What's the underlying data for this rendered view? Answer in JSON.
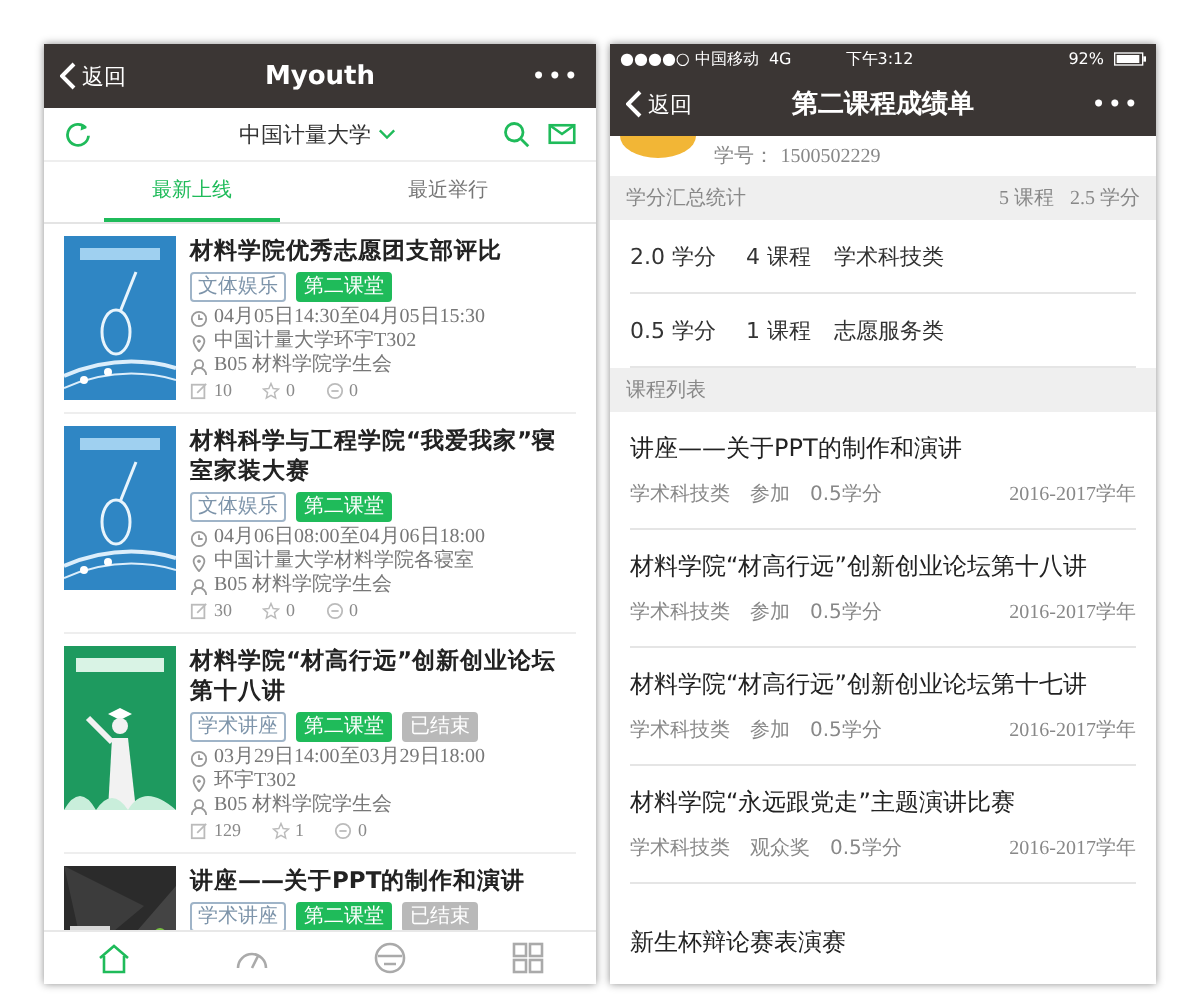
{
  "left_screen": {
    "nav": {
      "back": "返回",
      "title": "Myouth",
      "more": "•••"
    },
    "toolbar": {
      "school": "中国计量大学"
    },
    "tabs": [
      {
        "label": "最新上线",
        "selected": true
      },
      {
        "label": "最近举行",
        "selected": false
      }
    ],
    "activities": [
      {
        "poster": {
          "kind": "arts"
        },
        "title": "材料学院优秀志愿团支部评比",
        "tags": [
          {
            "label": "文体娱乐",
            "kind": "category"
          },
          {
            "label": "第二课堂",
            "kind": "course"
          }
        ],
        "time": "04月05日14:30至04月05日15:30",
        "place": "中国计量大学环宇T302",
        "organizer": "B05 材料学院学生会",
        "stats": {
          "views": "10",
          "likes": "0",
          "comments": "0"
        }
      },
      {
        "poster": {
          "kind": "arts"
        },
        "title": "材料科学与工程学院“我爱我家”寝室家装大赛",
        "tags": [
          {
            "label": "文体娱乐",
            "kind": "category"
          },
          {
            "label": "第二课堂",
            "kind": "course"
          }
        ],
        "time": "04月06日08:00至04月06日18:00",
        "place": "中国计量大学材料学院各寝室",
        "organizer": "B05 材料学院学生会",
        "stats": {
          "views": "30",
          "likes": "0",
          "comments": "0"
        }
      },
      {
        "poster": {
          "kind": "lecture"
        },
        "title": "材料学院“材高行远”创新创业论坛第十八讲",
        "tags": [
          {
            "label": "学术讲座",
            "kind": "category"
          },
          {
            "label": "第二课堂",
            "kind": "course"
          },
          {
            "label": "已结束",
            "kind": "ended"
          }
        ],
        "time": "03月29日14:00至03月29日18:00",
        "place": "环宇T302",
        "organizer": "B05 材料学院学生会",
        "stats": {
          "views": "129",
          "likes": "1",
          "comments": "0"
        }
      },
      {
        "poster": {
          "kind": "dark"
        },
        "title": "讲座——关于PPT的制作和演讲",
        "tags": [
          {
            "label": "学术讲座",
            "kind": "category"
          },
          {
            "label": "第二课堂",
            "kind": "course"
          },
          {
            "label": "已结束",
            "kind": "ended"
          }
        ]
      }
    ],
    "bottom_tabs": [
      {
        "selected": true
      },
      {
        "selected": false
      },
      {
        "selected": false
      },
      {
        "selected": false
      }
    ]
  },
  "right_screen": {
    "status_bar": {
      "carrier": "●●●●○ 中国移动",
      "network": "4G",
      "time": "下午3:12",
      "battery": "92%"
    },
    "nav": {
      "back": "返回",
      "title": "第二课程成绩单",
      "more": "•••"
    },
    "student_id": {
      "label": "学号：",
      "value": "1500502229"
    },
    "summary": {
      "title": "学分汇总统计",
      "courses": "5 课程",
      "credits": "2.5 学分",
      "rows": [
        {
          "credits": "2.0 学分",
          "courses": "4 课程",
          "category": "学术科技类"
        },
        {
          "credits": "0.5 学分",
          "courses": "1 课程",
          "category": "志愿服务类"
        }
      ]
    },
    "course_list": {
      "title": "课程列表",
      "items": [
        {
          "title": "讲座——关于PPT的制作和演讲",
          "category": "学术科技类",
          "award": "参加",
          "credits": "0.5学分",
          "year": "2016-2017学年"
        },
        {
          "title": "材料学院“材高行远”创新创业论坛第十八讲",
          "category": "学术科技类",
          "award": "参加",
          "credits": "0.5学分",
          "year": "2016-2017学年"
        },
        {
          "title": "材料学院“材高行远”创新创业论坛第十七讲",
          "category": "学术科技类",
          "award": "参加",
          "credits": "0.5学分",
          "year": "2016-2017学年"
        },
        {
          "title": "材料学院“永远跟党走”主题演讲比赛",
          "category": "学术科技类",
          "award": "观众奖",
          "credits": "0.5学分",
          "year": "2016-2017学年"
        },
        {
          "title": "新生杯辩论赛表演赛"
        }
      ]
    }
  }
}
